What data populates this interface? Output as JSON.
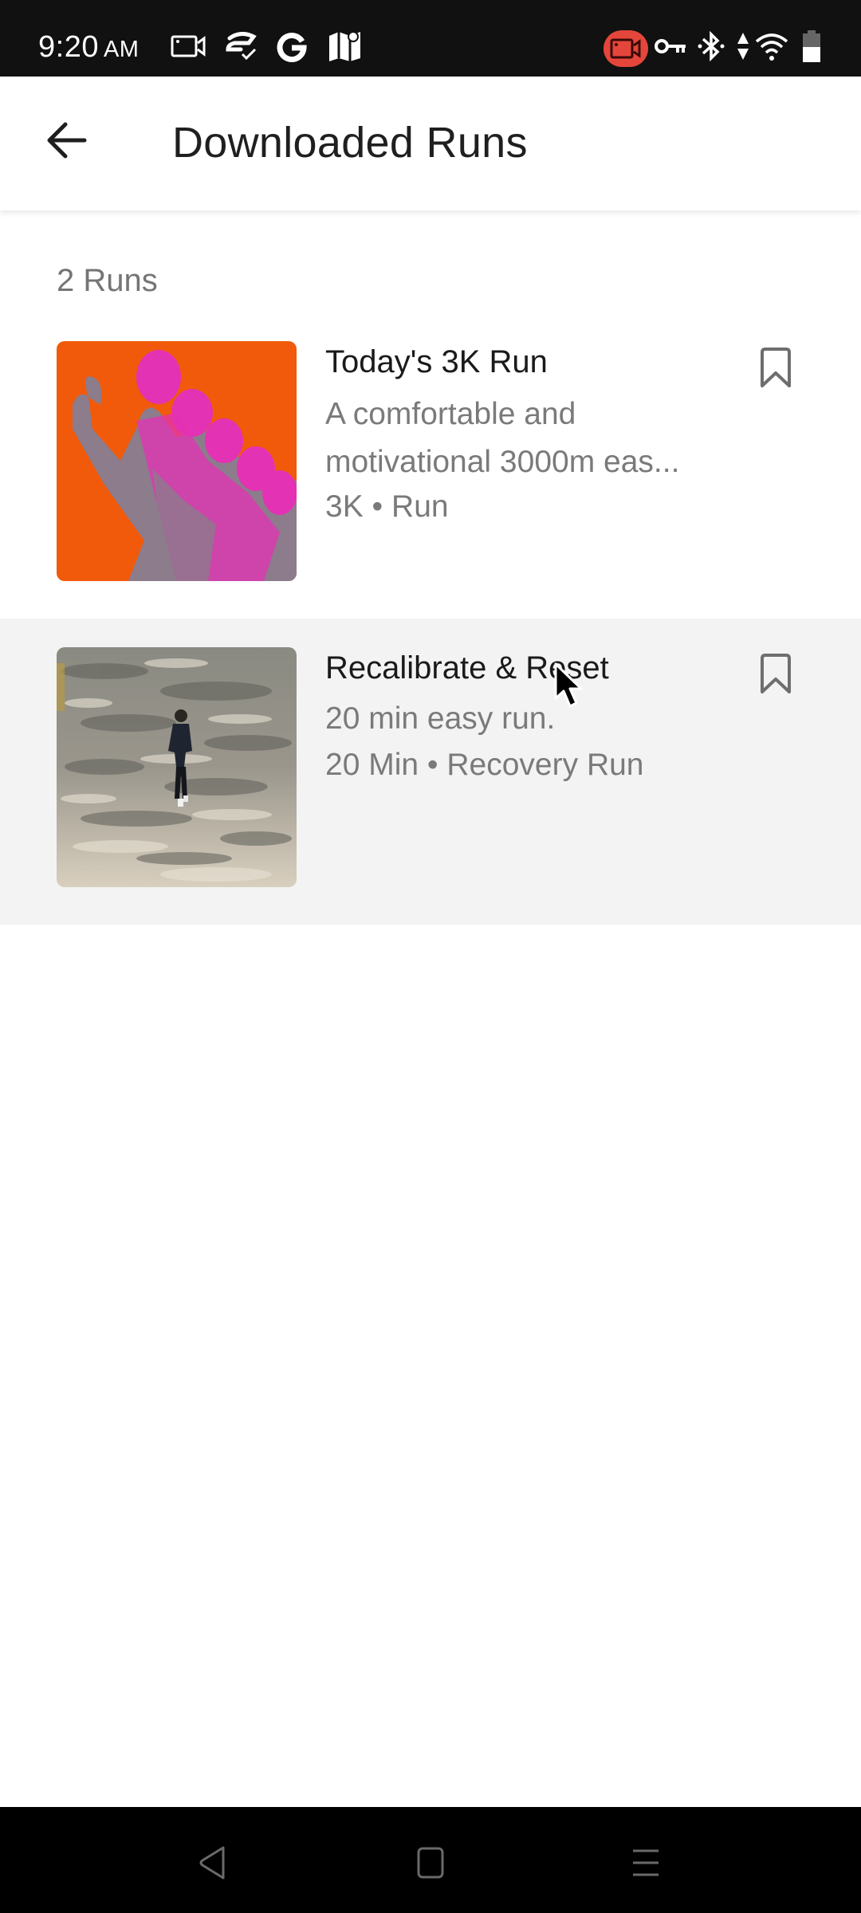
{
  "status_bar": {
    "time": "9:20",
    "ampm": "AM",
    "left_icons": [
      "screen-record-icon",
      "messaging-app-icon",
      "google-icon",
      "maps-icon"
    ],
    "right_icons": [
      "screen-recording-active-icon",
      "vpn-key-icon",
      "bluetooth-icon",
      "data-arrows-icon",
      "wifi-icon",
      "battery-icon"
    ],
    "record_badge_color": "#e5463b"
  },
  "app_bar": {
    "back_icon": "arrow-left-icon",
    "title": "Downloaded Runs"
  },
  "list": {
    "count_label": "2 Runs",
    "items": [
      {
        "title": "Today's 3K Run",
        "description": "A comfortable and motivational 3000m eas...",
        "meta": "3K • Run",
        "thumbnail": "runners-group-orange-pink",
        "thumbnail_bg": "#f05a0a",
        "bookmark_icon": "bookmark-outline-icon",
        "highlighted": false
      },
      {
        "title": "Recalibrate & Reset",
        "description": "20 min easy run.",
        "meta": "20 Min • Recovery Run",
        "thumbnail": "runner-on-shaded-path",
        "bookmark_icon": "bookmark-outline-icon",
        "highlighted": true
      }
    ]
  },
  "nav_bar": {
    "buttons": [
      "nav-back-icon",
      "nav-home-icon",
      "nav-recents-icon"
    ]
  }
}
